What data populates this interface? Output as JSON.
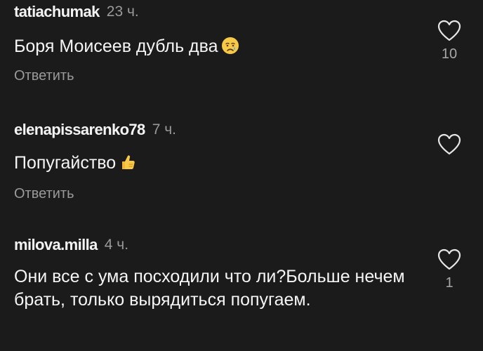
{
  "comments": [
    {
      "username": "tatiachumak",
      "time": "23 ч.",
      "text": "Боря Моисеев дубль два",
      "emoji": "crying-face-icon",
      "reply_label": "Ответить",
      "likes": "10"
    },
    {
      "username": "elenapissarenko78",
      "time": "7 ч.",
      "text": "Попугайство",
      "emoji": "thumbs-up-icon",
      "reply_label": "Ответить",
      "likes": ""
    },
    {
      "username": "milova.milla",
      "time": "4 ч.",
      "text": "Они все с ума посходили что ли?Больше нечем брать, только вырядиться попугаем.",
      "reply_label": "",
      "likes": "1"
    }
  ],
  "colors": {
    "background": "#1b1b1b",
    "text": "#f5f5f5",
    "muted": "#9a9a9a",
    "emoji_yellow": "#f7c948"
  }
}
